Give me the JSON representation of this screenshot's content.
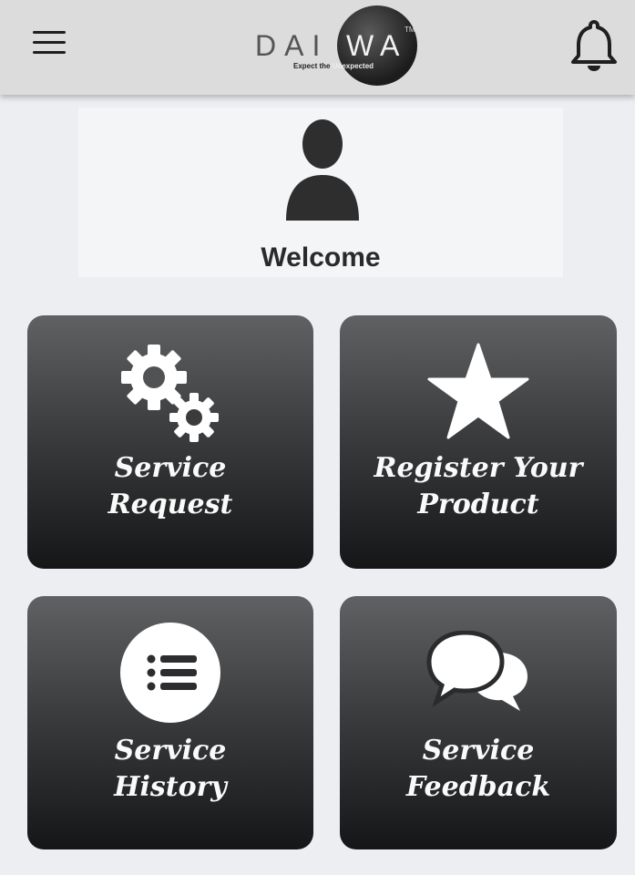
{
  "header": {
    "logo": {
      "text_left": "DAI",
      "text_right": "WA",
      "tm": "TM",
      "tagline_dark": "Expect the ",
      "tagline_light": "Unexpected"
    },
    "menu_icon": "hamburger-menu-icon",
    "notification_icon": "bell-icon"
  },
  "profile": {
    "avatar_icon": "user-silhouette-icon",
    "welcome_text": "Welcome"
  },
  "tiles": [
    {
      "icon": "gears-icon",
      "line1": "Service",
      "line2": "Request"
    },
    {
      "icon": "star-icon",
      "line1": "Register Your",
      "line2": "Product"
    },
    {
      "icon": "list-icon",
      "line1": "Service",
      "line2": "History"
    },
    {
      "icon": "chat-bubbles-icon",
      "line1": "Service",
      "line2": "Feedback"
    }
  ],
  "colors": {
    "header_bg": "#dcdcdc",
    "page_bg": "#eceef1",
    "tile_top": "#5f6163",
    "tile_bottom": "#151617",
    "icon_color": "#ffffff"
  }
}
